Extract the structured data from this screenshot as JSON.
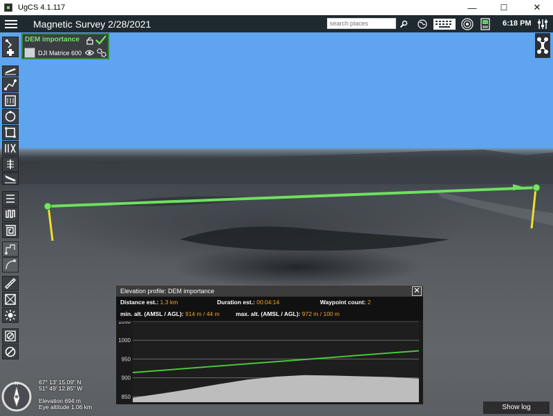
{
  "window": {
    "title": "UgCS 4.1.117",
    "controls": [
      "—",
      "☐",
      "✕"
    ]
  },
  "header": {
    "mission_title": "Magnetic Survey 2/28/2021",
    "search_placeholder": "search places",
    "time": "6:18 PM",
    "icons": [
      "search-icon",
      "globe-icon",
      "keyboard-icon",
      "adsb-icon",
      "telemetry-icon",
      "settings-sliders-icon"
    ]
  },
  "route_card": {
    "name": "DEM importance",
    "vehicle": "DJI Matrice 600"
  },
  "toolbar": {
    "icons": [
      "add-route-icon",
      "takeoff-icon",
      "waypoint-icon",
      "area-scan-icon",
      "circle-icon",
      "perimeter-icon",
      "photogrammetry-icon",
      "corridor-icon",
      "landing-icon",
      "vertical-scan-icon",
      "survey-pattern-icon",
      "spiral-icon",
      "route-segments-icon",
      "route-curve-icon",
      "ruler-icon",
      "grid-icon",
      "sun-icon",
      "no-fly-zone-icon",
      "no-fly-circle-icon"
    ]
  },
  "elevation_profile": {
    "title": "Elevation profile: DEM importance",
    "distance_label": "Distance est.:",
    "distance_value": "1.3 km",
    "duration_label": "Duration est.:",
    "duration_value": "00:04:14",
    "waypoint_label": "Waypoint count:",
    "waypoint_value": "2",
    "min_alt_label": "min. alt. (AMSL / AGL):",
    "min_alt_value": "914 m / 44 m",
    "max_alt_label": "max. alt. (AMSL / AGL):",
    "max_alt_value": "972 m / 100 m",
    "close": "✕"
  },
  "chart_data": {
    "type": "area",
    "y_ticks": [
      "1050",
      "1000",
      "950",
      "900",
      "850"
    ],
    "ylim": [
      835,
      1050
    ],
    "route_line": [
      {
        "x": 0,
        "y": 914
      },
      {
        "x": 1,
        "y": 972
      }
    ],
    "terrain": [
      {
        "x": 0.0,
        "y": 847
      },
      {
        "x": 0.1,
        "y": 858
      },
      {
        "x": 0.2,
        "y": 870
      },
      {
        "x": 0.3,
        "y": 883
      },
      {
        "x": 0.4,
        "y": 895
      },
      {
        "x": 0.5,
        "y": 903
      },
      {
        "x": 0.6,
        "y": 907
      },
      {
        "x": 0.7,
        "y": 906
      },
      {
        "x": 0.8,
        "y": 904
      },
      {
        "x": 0.9,
        "y": 902
      },
      {
        "x": 1.0,
        "y": 898
      }
    ],
    "colors": {
      "route": "#47c93a",
      "terrain": "#bdbdbd",
      "grid": "#6a6a6a",
      "bg": "#1e1e1e"
    }
  },
  "status": {
    "lat": "67° 13' 15.09\" N",
    "lon": "51° 49' 12.85\" W",
    "elevation": "Elevation 694 m",
    "eye_altitude": "Eye altitude 1.06 km"
  },
  "show_log": "Show log"
}
